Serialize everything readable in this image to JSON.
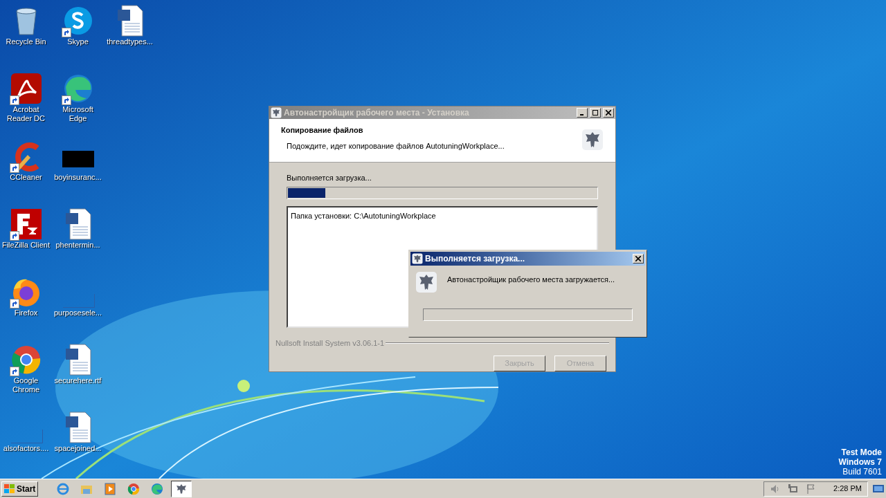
{
  "desktop_columns": [
    [
      {
        "label": "Recycle Bin",
        "kind": "recycle",
        "shortcut": false
      },
      {
        "label": "Acrobat Reader DC",
        "kind": "acrobat",
        "shortcut": true
      },
      {
        "label": "CCleaner",
        "kind": "ccleaner",
        "shortcut": true
      },
      {
        "label": "FileZilla Client",
        "kind": "filezilla",
        "shortcut": true
      },
      {
        "label": "Firefox",
        "kind": "firefox",
        "shortcut": true
      },
      {
        "label": "Google Chrome",
        "kind": "chrome",
        "shortcut": true
      },
      {
        "label": "alsofactors....",
        "kind": "blank",
        "shortcut": false
      }
    ],
    [
      {
        "label": "Skype",
        "kind": "skype",
        "shortcut": true
      },
      {
        "label": "Microsoft Edge",
        "kind": "edge",
        "shortcut": true
      },
      {
        "label": "boyinsuranc...",
        "kind": "black",
        "shortcut": false
      },
      {
        "label": "phentermin...",
        "kind": "word",
        "shortcut": false
      },
      {
        "label": "purposesele...",
        "kind": "blank",
        "shortcut": false
      },
      {
        "label": "securehere.rtf",
        "kind": "word",
        "shortcut": false
      },
      {
        "label": "spacejoined...",
        "kind": "word",
        "shortcut": false
      }
    ],
    [
      {
        "label": "threadtypes...",
        "kind": "word",
        "shortcut": false
      }
    ]
  ],
  "installer": {
    "title": "Автонастройщик рабочего места - Установка",
    "active": false,
    "heading": "Копирование файлов",
    "subheading": "Подождите, идет копирование файлов AutotuningWorkplace...",
    "status": "Выполняется загрузка...",
    "progress": {
      "level": 0.12
    },
    "log": [
      "Папка установки: C:\\AutotuningWorkplace"
    ],
    "branding": "Nullsoft Install System v3.06.1-1",
    "buttons": [
      {
        "label": "Закрыть",
        "disabled": true
      },
      {
        "label": "Отмена",
        "disabled": true
      }
    ]
  },
  "popup": {
    "title": "Выполняется загрузка...",
    "active": true,
    "message": "Автонастройщик рабочего места загружается..."
  },
  "watermark_lines": [
    "Test Mode",
    "Windows 7",
    "Build 7601"
  ],
  "taskbar": {
    "start": "Start",
    "apps": [
      {
        "kind": "ie",
        "selected": false
      },
      {
        "kind": "folder",
        "selected": false
      },
      {
        "kind": "media",
        "selected": false
      },
      {
        "kind": "chrome",
        "selected": false
      },
      {
        "kind": "edge",
        "selected": false
      },
      {
        "kind": "installer",
        "selected": true
      }
    ],
    "tray": [
      {
        "kind": "speaker"
      },
      {
        "kind": "network"
      },
      {
        "kind": "flag"
      }
    ],
    "time": "2:28 PM"
  }
}
